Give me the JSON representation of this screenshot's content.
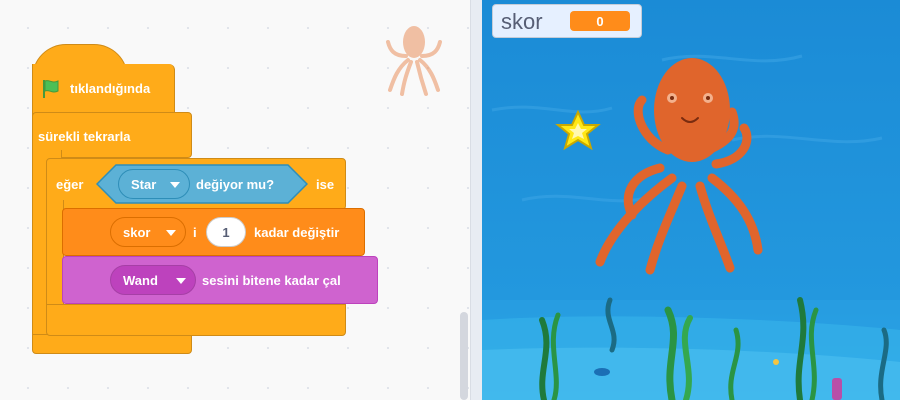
{
  "code_area": {
    "hat_block": {
      "label": "tıklandığında",
      "icon": "green-flag-icon"
    },
    "forever_block": {
      "label": "sürekli tekrarla"
    },
    "if_block": {
      "prefix": "eğer",
      "suffix": "ise"
    },
    "sensing_block": {
      "sprite": "Star",
      "label": "değiyor mu?"
    },
    "change_block": {
      "variable": "skor",
      "connector": "i",
      "amount": "1",
      "label": "kadar değiştir"
    },
    "sound_block": {
      "sound": "Wand",
      "label": "sesini bitene kadar çal"
    }
  },
  "stage": {
    "monitor": {
      "label": "skor",
      "value": "0"
    },
    "sprites": [
      "octopus",
      "star"
    ]
  },
  "colors": {
    "events": "#ffab19",
    "control": "#ffab19",
    "variables": "#ff8c1a",
    "sound": "#cf63cf",
    "sensing": "#5cb1d6",
    "stage_water": "#1e8fd6"
  }
}
